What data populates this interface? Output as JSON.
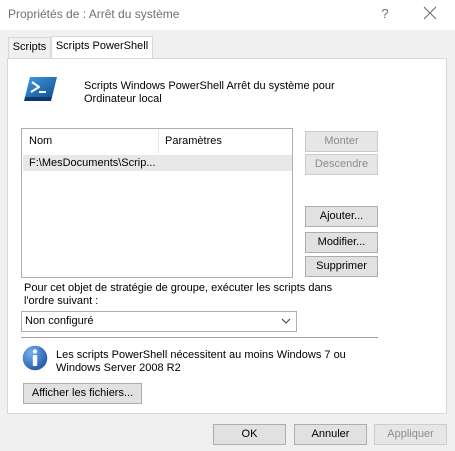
{
  "window": {
    "title": "Propriétés de : Arrêt du système",
    "help_glyph": "?"
  },
  "tabs": [
    {
      "label": "Scripts",
      "active": false
    },
    {
      "label": "Scripts PowerShell",
      "active": true
    }
  ],
  "panel": {
    "description": "Scripts Windows PowerShell Arrêt du système pour Ordinateur local",
    "list": {
      "columns": [
        "Nom",
        "Paramètres"
      ],
      "rows": [
        {
          "name": "F:\\MesDocuments\\Scrip...",
          "params": ""
        }
      ]
    },
    "side_buttons": {
      "up": "Monter",
      "down": "Descendre",
      "add": "Ajouter...",
      "edit": "Modifier...",
      "remove": "Supprimer"
    },
    "order_label": "Pour cet objet de stratégie de groupe, exécuter les scripts dans l'ordre suivant :",
    "order_select": {
      "value": "Non configuré"
    },
    "info_text": "Les scripts PowerShell nécessitent au moins Windows 7 ou Windows Server 2008 R2",
    "show_files": "Afficher les fichiers..."
  },
  "footer": {
    "ok": "OK",
    "cancel": "Annuler",
    "apply": "Appliquer"
  },
  "colors": {
    "powershell_blue": "#1e6fb8",
    "info_blue": "#1f63b5",
    "selected_row": "#e8e8e8"
  }
}
